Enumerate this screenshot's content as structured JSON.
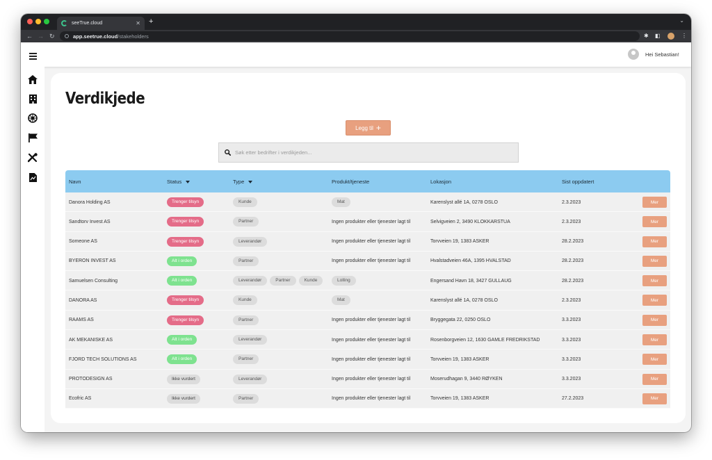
{
  "browser": {
    "tab_title": "seeTrue.cloud",
    "url_host": "app.seetrue.cloud",
    "url_path": "/stakeholders"
  },
  "header": {
    "greeting": "Hei Sebastian!"
  },
  "page": {
    "title": "Verdikjede",
    "add_button_label": "Legg til",
    "search_placeholder": "Søk etter bedrifter i verdikjeden..."
  },
  "table": {
    "columns": {
      "name": "Navn",
      "status": "Status",
      "type": "Type",
      "product": "Produkt/tjeneste",
      "location": "Lokasjon",
      "updated": "Sist oppdatert"
    },
    "more_label": "Mer",
    "rows": [
      {
        "name": "Danora Holding AS",
        "status": "Trenger tilsyn",
        "status_color": "#e46c88",
        "types": [
          "Kunde"
        ],
        "product": "Mat",
        "product_is_tag": true,
        "location": "Karenslyst allé 1A, 0278 OSLO",
        "updated": "2.3.2023"
      },
      {
        "name": "Sandtorv Invest AS",
        "status": "Trenger tilsyn",
        "status_color": "#e46c88",
        "types": [
          "Partner"
        ],
        "product": "Ingen produkter eller tjenester lagt til",
        "product_is_tag": false,
        "location": "Selvigveien 2, 3490 KLOKKARSTUA",
        "updated": "2.3.2023"
      },
      {
        "name": "Someone AS",
        "status": "Trenger tilsyn",
        "status_color": "#e46c88",
        "types": [
          "Leverandør"
        ],
        "product": "Ingen produkter eller tjenester lagt til",
        "product_is_tag": false,
        "location": "Torvveien 19, 1383 ASKER",
        "updated": "28.2.2023"
      },
      {
        "name": "BYERON INVEST AS",
        "status": "Alt i orden",
        "status_color": "#7ee28f",
        "types": [
          "Partner"
        ],
        "product": "Ingen produkter eller tjenester lagt til",
        "product_is_tag": false,
        "location": "Hvalstadveien 46A, 1395 HVALSTAD",
        "updated": "28.2.2023"
      },
      {
        "name": "Samuelsen Consulting",
        "status": "Alt i orden",
        "status_color": "#7ee28f",
        "types": [
          "Leverandør",
          "Partner",
          "Kunde"
        ],
        "product": "Lolling",
        "product_is_tag": true,
        "location": "Engersand Havn 18, 3427 GULLAUG",
        "updated": "28.2.2023"
      },
      {
        "name": "DANORA AS",
        "status": "Trenger tilsyn",
        "status_color": "#e46c88",
        "types": [
          "Kunde"
        ],
        "product": "Mat",
        "product_is_tag": true,
        "location": "Karenslyst allé 1A, 0278 OSLO",
        "updated": "2.3.2023"
      },
      {
        "name": "RAAMS AS",
        "status": "Trenger tilsyn",
        "status_color": "#e46c88",
        "types": [
          "Partner"
        ],
        "product": "Ingen produkter eller tjenester lagt til",
        "product_is_tag": false,
        "location": "Bryggegata 22, 0250 OSLO",
        "updated": "3.3.2023"
      },
      {
        "name": "AK MEKANISKE AS",
        "status": "Alt i orden",
        "status_color": "#7ee28f",
        "types": [
          "Leverandør"
        ],
        "product": "Ingen produkter eller tjenester lagt til",
        "product_is_tag": false,
        "location": "Rosenborgveien 12, 1630 GAMLE FREDRIKSTAD",
        "updated": "3.3.2023"
      },
      {
        "name": "FJORD TECH SOLUTIONS AS",
        "status": "Alt i orden",
        "status_color": "#7ee28f",
        "types": [
          "Partner"
        ],
        "product": "Ingen produkter eller tjenester lagt til",
        "product_is_tag": false,
        "location": "Torvveien 19, 1383 ASKER",
        "updated": "3.3.2023"
      },
      {
        "name": "PROTODESIGN AS",
        "status": "Ikke vurdert",
        "status_color": "#dcdcdc",
        "types": [
          "Leverandør"
        ],
        "product": "Ingen produkter eller tjenester lagt til",
        "product_is_tag": false,
        "location": "Moserudhagan 9, 3440 RØYKEN",
        "updated": "3.3.2023"
      },
      {
        "name": "Ecofric AS",
        "status": "Ikke vurdert",
        "status_color": "#dcdcdc",
        "types": [
          "Partner"
        ],
        "product": "Ingen produkter eller tjenester lagt til",
        "product_is_tag": false,
        "location": "Torvveien 19, 1383 ASKER",
        "updated": "27.2.2023"
      }
    ]
  },
  "sidebar": {
    "icons": [
      "home-icon",
      "building-icon",
      "network-icon",
      "flag-icon",
      "tools-icon",
      "document-icon"
    ]
  },
  "colors": {
    "accent": "#e8a07f",
    "table_header": "#8ccbf0",
    "needs_attention": "#e46c88",
    "ok": "#7ee28f",
    "neutral": "#dcdcdc"
  }
}
